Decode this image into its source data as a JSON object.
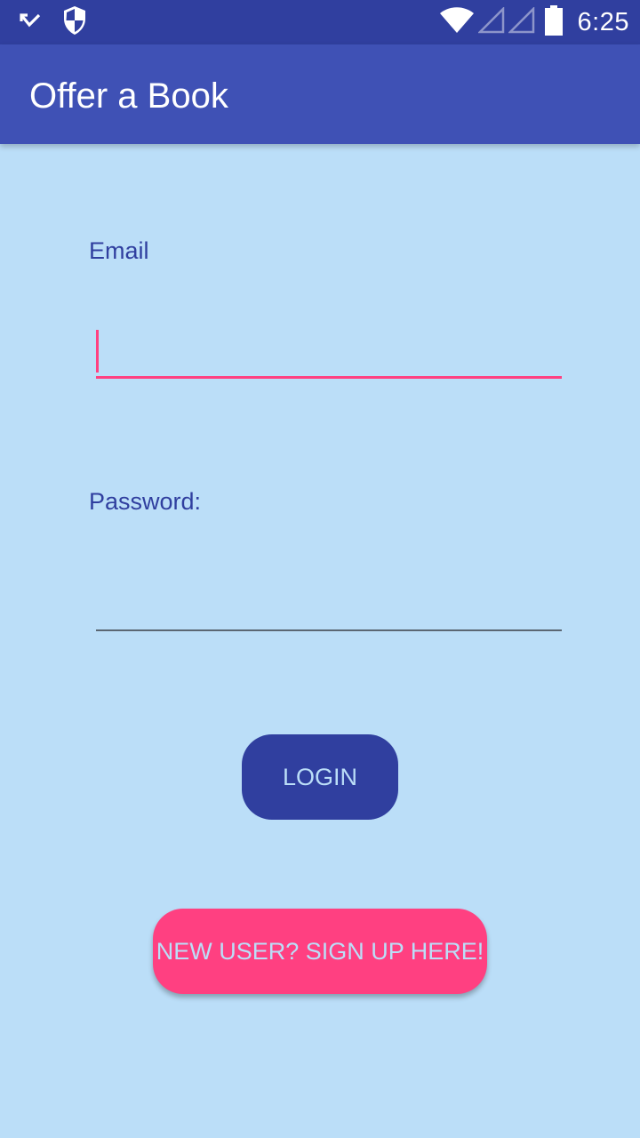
{
  "status_bar": {
    "time": "6:25",
    "icons": [
      "missed-call-icon",
      "shield-icon",
      "wifi-icon",
      "signal-icon",
      "signal-icon",
      "battery-icon"
    ]
  },
  "app_bar": {
    "title": "Offer a Book"
  },
  "form": {
    "email_label": "Email",
    "email_value": "",
    "password_label": "Password:",
    "password_value": ""
  },
  "buttons": {
    "login_label": "LOGIN",
    "signup_label": "NEW USER? SIGN UP HERE!"
  },
  "colors": {
    "background": "#BBDEF8",
    "status_bar": "#303F9F",
    "app_bar": "#3F51B5",
    "primary_dark": "#303F9F",
    "accent": "#FF4081"
  }
}
